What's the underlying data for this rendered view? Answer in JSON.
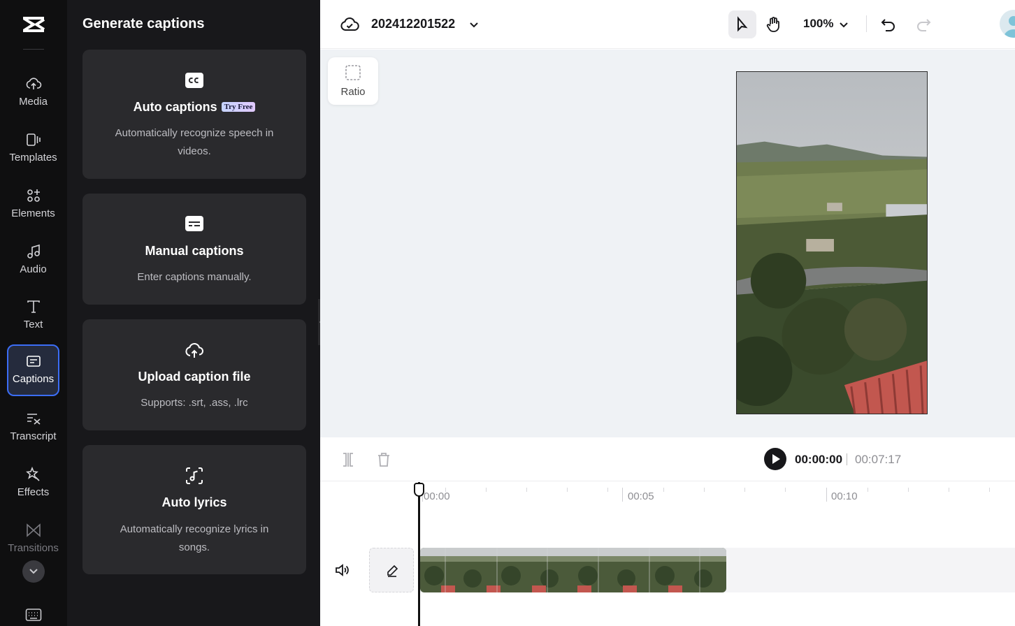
{
  "sidebar": {
    "items": [
      {
        "label": "Media",
        "icon": "cloud-upload-icon"
      },
      {
        "label": "Templates",
        "icon": "templates-icon"
      },
      {
        "label": "Elements",
        "icon": "elements-icon"
      },
      {
        "label": "Audio",
        "icon": "music-note-icon"
      },
      {
        "label": "Text",
        "icon": "text-icon"
      },
      {
        "label": "Captions",
        "icon": "captions-icon",
        "active": true
      },
      {
        "label": "Transcript",
        "icon": "transcript-icon"
      },
      {
        "label": "Effects",
        "icon": "effects-icon"
      },
      {
        "label": "Transitions",
        "icon": "transitions-icon"
      }
    ]
  },
  "panel": {
    "title": "Generate captions",
    "cards": [
      {
        "title": "Auto captions",
        "badge": "Try Free",
        "desc": "Automatically recognize speech in videos.",
        "icon": "cc-icon"
      },
      {
        "title": "Manual captions",
        "desc": "Enter captions manually.",
        "icon": "caption-box-icon"
      },
      {
        "title": "Upload caption file",
        "desc": "Supports: .srt, .ass, .lrc",
        "icon": "cloud-upload-icon"
      },
      {
        "title": "Auto lyrics",
        "desc": "Automatically recognize lyrics in songs.",
        "icon": "lyrics-icon"
      }
    ]
  },
  "topbar": {
    "project_name": "202412201522",
    "zoom": "100%"
  },
  "canvas": {
    "ratio_label": "Ratio"
  },
  "player": {
    "current_time": "00:00:00",
    "total_time": "00:07:17"
  },
  "timeline": {
    "ticks": [
      "00:00",
      "00:05",
      "00:10"
    ]
  },
  "colors": {
    "accent": "#3b6df6",
    "rail_bg": "#0f0f10",
    "panel_bg": "#18181b",
    "card_bg": "#2a2a2d",
    "canvas_bg": "#eff2f5"
  }
}
